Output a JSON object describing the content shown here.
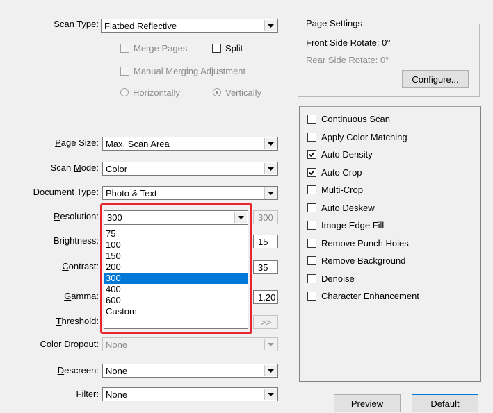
{
  "left": {
    "scan_type": {
      "label_u": "S",
      "label_rest": "can Type:",
      "value": "Flatbed Reflective"
    },
    "merge_pages": "Merge Pages",
    "split": "Split",
    "manual_merging": "Manual Merging Adjustment",
    "horizontally": "Horizontally",
    "vertically": "Vertically",
    "page_size": {
      "label_u": "P",
      "label_rest": "age Size:",
      "value": "Max. Scan Area"
    },
    "scan_mode": {
      "label_pre": "Scan ",
      "label_u": "M",
      "label_rest": "ode:",
      "value": "Color"
    },
    "document_type": {
      "label_u": "D",
      "label_rest": "ocument Type:",
      "value": "Photo & Text"
    },
    "resolution": {
      "label_u": "R",
      "label_rest": "esolution:",
      "value": "300",
      "readout": "300"
    },
    "brightness": {
      "label_pre": "Bri",
      "label_u": "g",
      "label_rest": "htness:",
      "readout": "15"
    },
    "contrast": {
      "label_u": "C",
      "label_rest": "ontrast:",
      "readout": "35"
    },
    "gamma": {
      "label_u": "G",
      "label_rest": "amma:",
      "readout": "1.20"
    },
    "threshold": {
      "label_u": "T",
      "label_rest": "hreshold:",
      "button": ">>"
    },
    "color_dropout": {
      "label_pre": "Color Dr",
      "label_u": "o",
      "label_rest": "pout:",
      "value": "None"
    },
    "descreen": {
      "label_u": "D",
      "label_rest": "escreen:",
      "value": "None"
    },
    "filter": {
      "label_u": "F",
      "label_rest": "ilter:",
      "value": "None"
    }
  },
  "resolution_options": [
    "75",
    "100",
    "150",
    "200",
    "300",
    "400",
    "600",
    "Custom"
  ],
  "resolution_selected_index": 4,
  "page_settings": {
    "title": "Page Settings",
    "front": "Front Side Rotate: 0°",
    "rear": "Rear Side Rotate: 0°",
    "configure": "Configure..."
  },
  "options": [
    {
      "label": "Continuous Scan",
      "checked": false
    },
    {
      "label": "Apply Color Matching",
      "checked": false
    },
    {
      "label": "Auto Density",
      "checked": true
    },
    {
      "label": "Auto Crop",
      "checked": true
    },
    {
      "label": "Multi-Crop",
      "checked": false
    },
    {
      "label": "Auto Deskew",
      "checked": false
    },
    {
      "label": "Image Edge Fill",
      "checked": false
    },
    {
      "label": "Remove Punch Holes",
      "checked": false
    },
    {
      "label": "Remove Background",
      "checked": false
    },
    {
      "label": "Denoise",
      "checked": false
    },
    {
      "label": "Character Enhancement",
      "checked": false
    }
  ],
  "buttons": {
    "preview": "Preview",
    "default": "Default"
  },
  "colors": {
    "selection": "#0078d7",
    "highlight_frame": "#e5272d"
  }
}
